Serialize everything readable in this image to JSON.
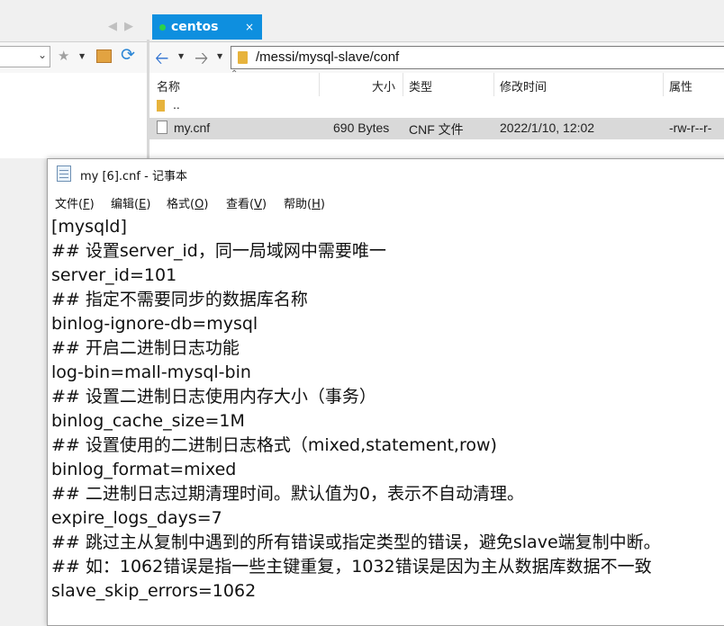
{
  "file_manager": {
    "tab": {
      "label": "centos",
      "close_glyph": "×"
    },
    "address_path": "/messi/mysql-slave/conf",
    "columns": {
      "name": "名称",
      "size": "大小",
      "type": "类型",
      "modified": "修改时间",
      "attributes": "属性"
    },
    "rows": [
      {
        "name": ".."
      },
      {
        "name": "my.cnf",
        "size": "690 Bytes",
        "type": "CNF 文件",
        "modified": "2022/1/10, 12:02",
        "attributes": "-rw-r--r-"
      }
    ]
  },
  "notepad": {
    "title": "my [6].cnf - 记事本",
    "menu": [
      {
        "label": "文件",
        "key": "F"
      },
      {
        "label": "编辑",
        "key": "E"
      },
      {
        "label": "格式",
        "key": "O"
      },
      {
        "label": "查看",
        "key": "V"
      },
      {
        "label": "帮助",
        "key": "H"
      }
    ],
    "lines": [
      "[mysqld]",
      "## 设置server_id，同一局域网中需要唯一",
      "server_id=101",
      "## 指定不需要同步的数据库名称",
      "binlog-ignore-db=mysql",
      "## 开启二进制日志功能",
      "log-bin=mall-mysql-bin",
      "## 设置二进制日志使用内存大小（事务）",
      "binlog_cache_size=1M",
      "## 设置使用的二进制日志格式（mixed,statement,row)",
      "binlog_format=mixed",
      "## 二进制日志过期清理时间。默认值为0，表示不自动清理。",
      "expire_logs_days=7",
      "## 跳过主从复制中遇到的所有错误或指定类型的错误，避免slave端复制中断。",
      "## 如：1062错误是指一些主键重复，1032错误是因为主从数据库数据不一致",
      "slave_skip_errors=1062"
    ]
  }
}
